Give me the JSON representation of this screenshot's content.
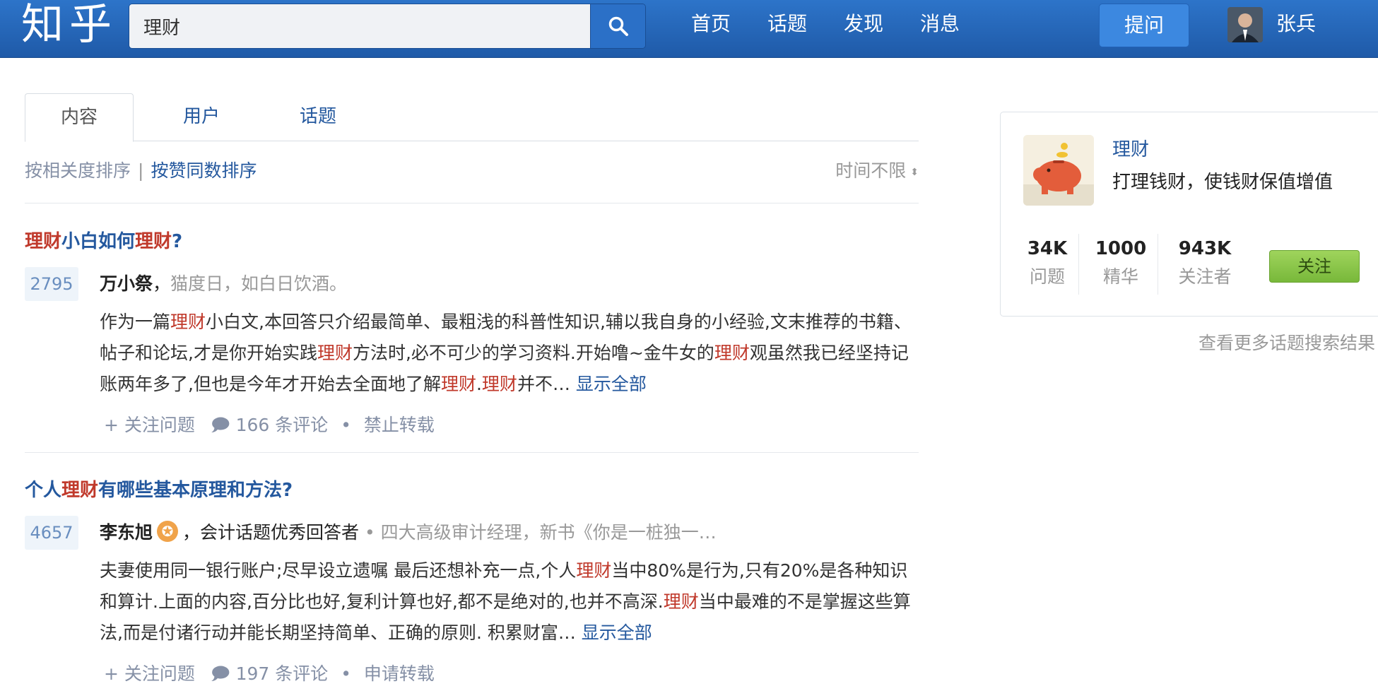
{
  "header": {
    "logo": "知乎",
    "search_value": "理财",
    "nav": [
      "首页",
      "话题",
      "发现",
      "消息"
    ],
    "ask_label": "提问",
    "user_name": "张兵",
    "colors": {
      "bar": "#2a6ac0",
      "accent": "#24589e",
      "highlight": "#c0392b",
      "follow": "#8cc64c"
    }
  },
  "tabs": [
    "内容",
    "用户",
    "话题"
  ],
  "sort": {
    "relevance": "按相关度排序",
    "separator": "|",
    "votes": "按赞同数排序",
    "time_filter": "时间不限"
  },
  "results": [
    {
      "title": [
        {
          "t": "理财",
          "hl": true
        },
        {
          "t": "小白如何",
          "hl": false
        },
        {
          "t": "理财",
          "hl": true
        },
        {
          "t": "?",
          "hl": false
        }
      ],
      "votes": "2795",
      "author": "万小祭",
      "author_sep": "，",
      "bio": "猫度日，如白日饮酒。",
      "has_badge": false,
      "excerpt": [
        {
          "t": "作为一篇",
          "hl": false
        },
        {
          "t": "理财",
          "hl": true
        },
        {
          "t": "小白文,本回答只介绍最简单、最粗浅的科普性知识,辅以我自身的小经验,文末推荐的书籍、帖子和论坛,才是你开始实践",
          "hl": false
        },
        {
          "t": "理财",
          "hl": true
        },
        {
          "t": "方法时,必不可少的学习资料.开始噜~金牛女的",
          "hl": false
        },
        {
          "t": "理财",
          "hl": true
        },
        {
          "t": "观虽然我已经坚持记账两年多了,但也是今年才开始去全面地了解",
          "hl": false
        },
        {
          "t": "理财",
          "hl": true
        },
        {
          "t": ".",
          "hl": false
        },
        {
          "t": "理财",
          "hl": true
        },
        {
          "t": "并不… ",
          "hl": false
        }
      ],
      "show_all": "显示全部",
      "follow": "关注问题",
      "comments": "166 条评论",
      "extra": "禁止转载"
    },
    {
      "title": [
        {
          "t": "个人",
          "hl": false
        },
        {
          "t": "理财",
          "hl": true
        },
        {
          "t": "有哪些基本原理和方法?",
          "hl": false
        }
      ],
      "votes": "4657",
      "author": "李东旭",
      "author_sep": "，",
      "bio": "会计话题优秀回答者",
      "bio_extra": " • 四大高级审计经理，新书《你是一桩独一…",
      "has_badge": true,
      "excerpt": [
        {
          "t": "夫妻使用同一银行账户;尽早设立遗嘱 最后还想补充一点,个人",
          "hl": false
        },
        {
          "t": "理财",
          "hl": true
        },
        {
          "t": "当中80%是行为,只有20%是各种知识和算计.上面的内容,百分比也好,复利计算也好,都不是绝对的,也并不高深.",
          "hl": false
        },
        {
          "t": "理财",
          "hl": true
        },
        {
          "t": "当中最难的不是掌握这些算法,而是付诸行动并能长期坚持简单、正确的原则. 积累财富… ",
          "hl": false
        }
      ],
      "show_all": "显示全部",
      "follow": "关注问题",
      "comments": "197 条评论",
      "extra": "申请转载"
    }
  ],
  "topic_card": {
    "name": "理财",
    "description": "打理钱财，使钱财保值增值",
    "stats": [
      {
        "num": "34K",
        "label": "问题"
      },
      {
        "num": "1000",
        "label": "精华"
      },
      {
        "num": "943K",
        "label": "关注者"
      }
    ],
    "follow_label": "关注",
    "more_link": "查看更多话题搜索结果"
  }
}
